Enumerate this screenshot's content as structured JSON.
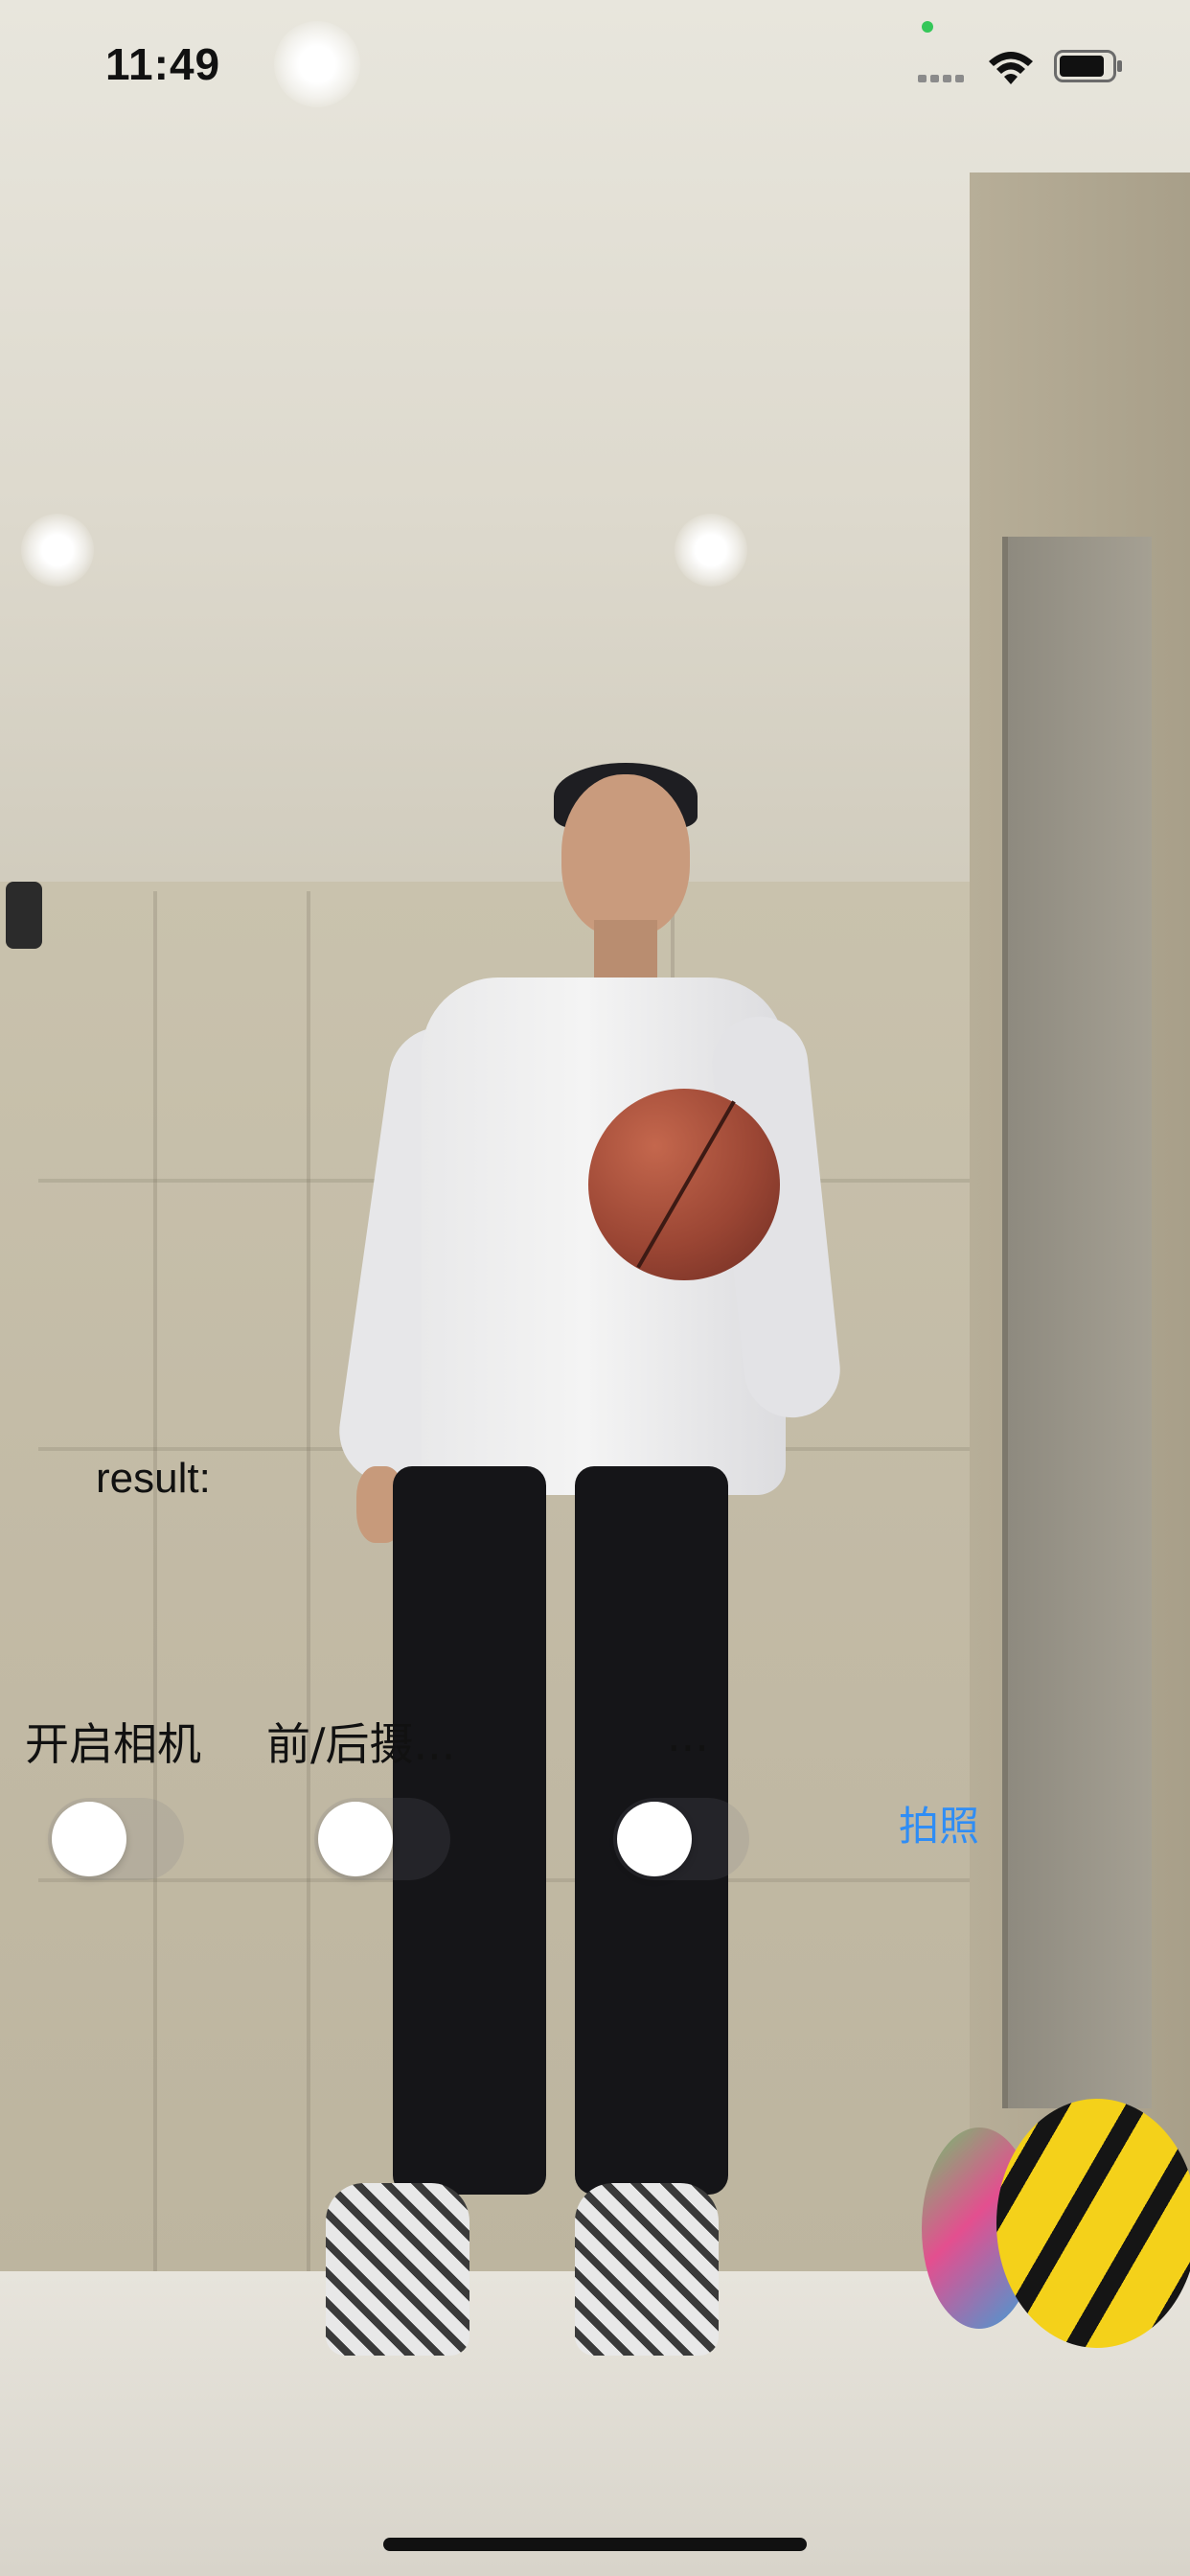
{
  "status_bar": {
    "time": "11:49"
  },
  "overlay": {
    "result_label": "result:"
  },
  "controls": {
    "open_camera_label": "开启相机",
    "front_back_label": "前/后摄...",
    "third_label": "...",
    "open_camera_on": false,
    "front_back_on": false,
    "third_on": false,
    "photo_button": "拍照"
  },
  "colors": {
    "accent": "#2f8df5",
    "text": "#111111"
  }
}
